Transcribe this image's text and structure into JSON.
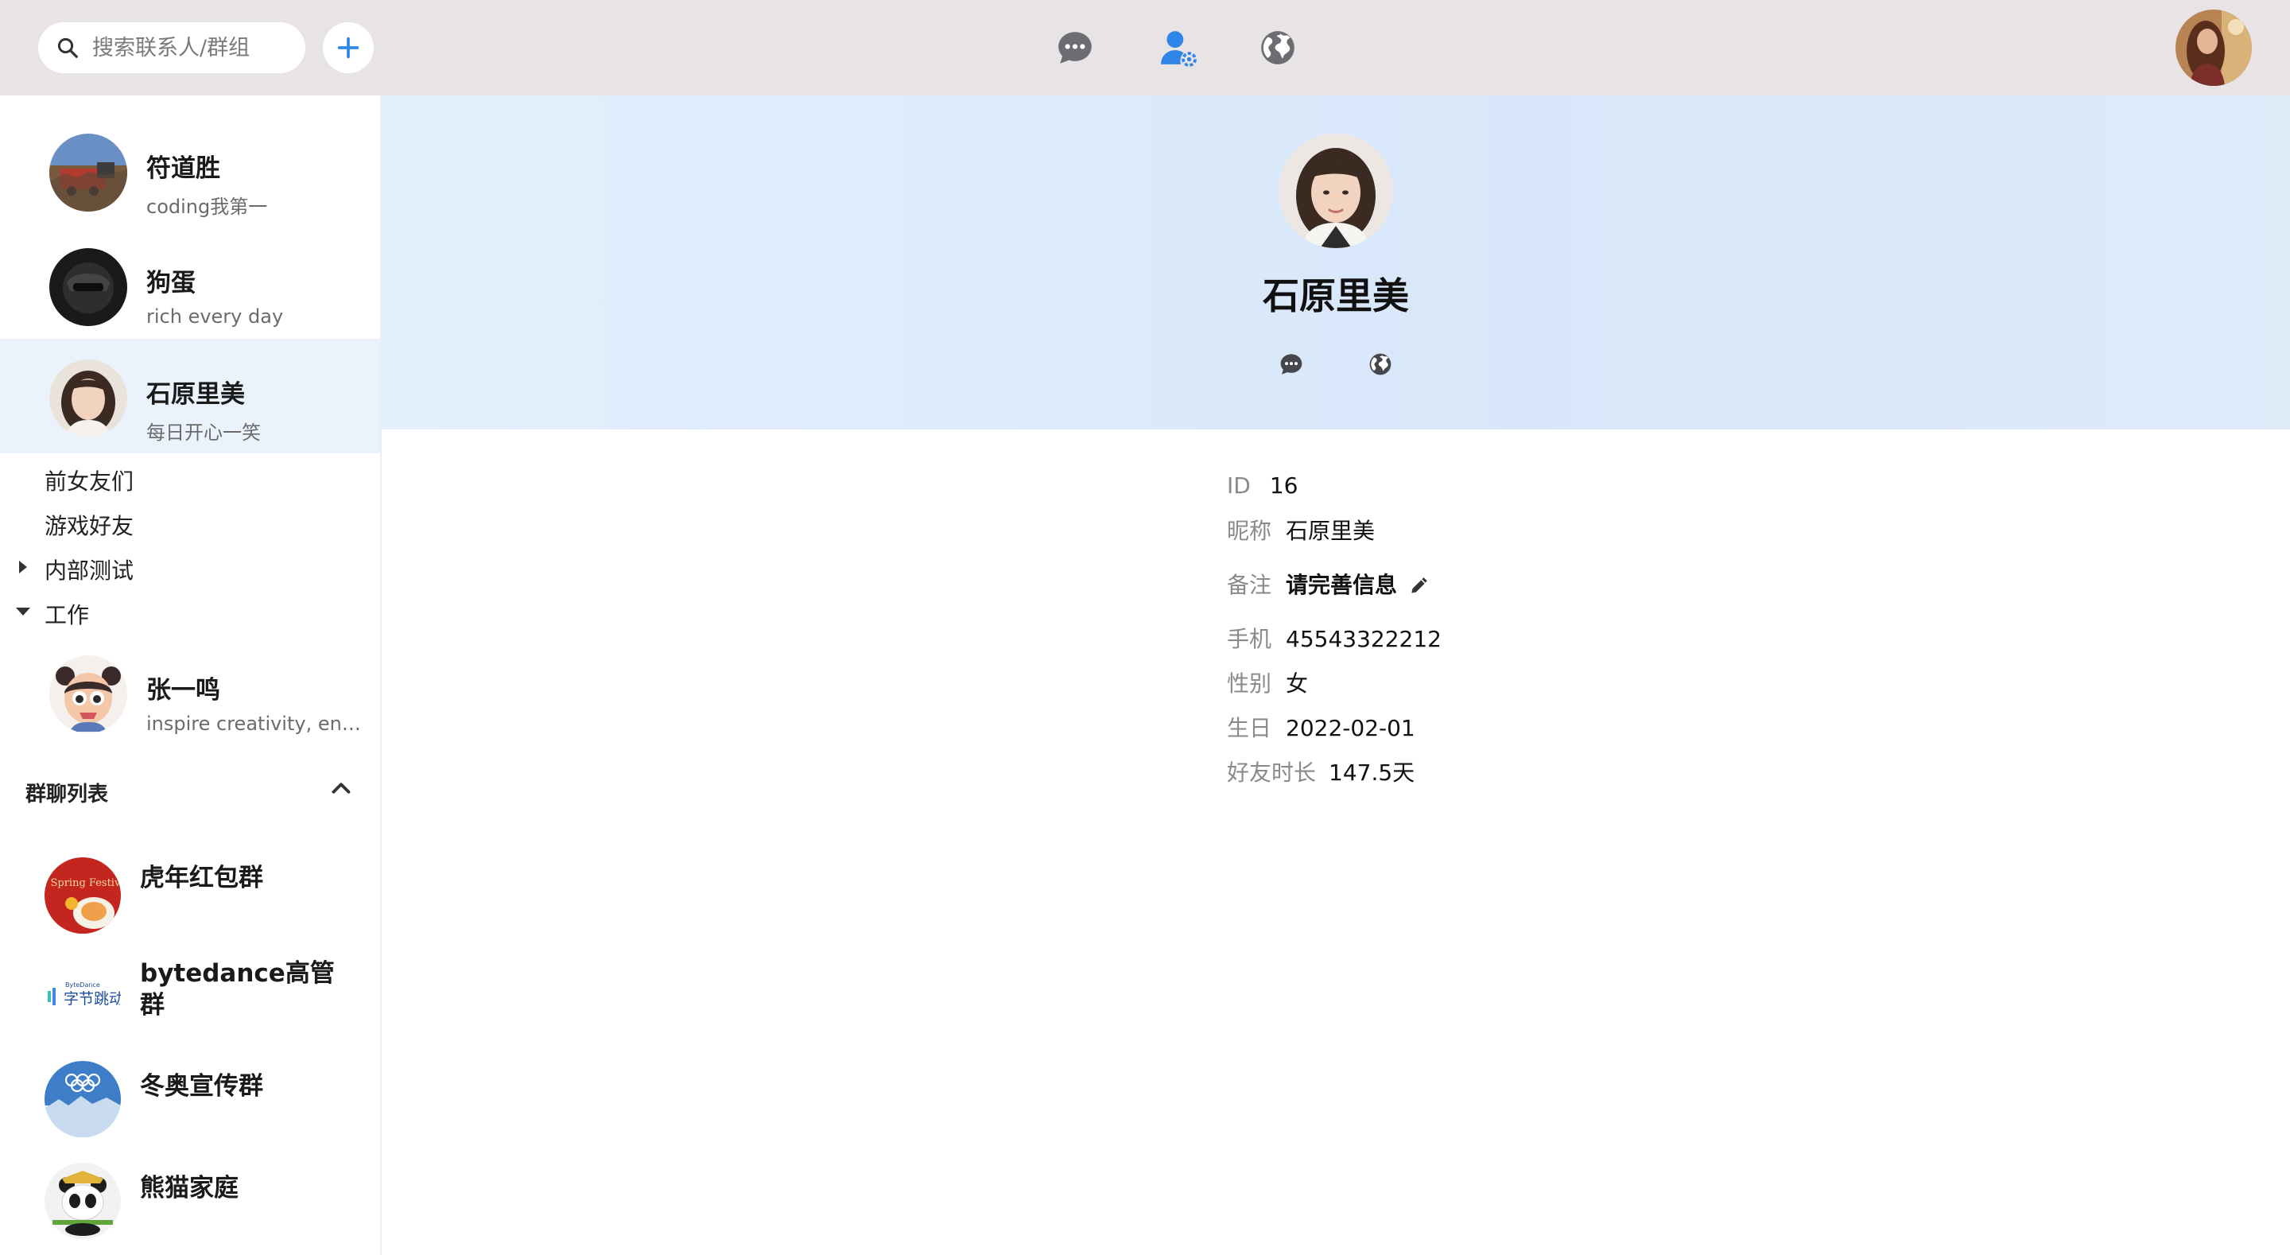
{
  "header": {
    "search_placeholder": "搜索联系人/群组",
    "add_icon": "plus-icon",
    "nav": [
      {
        "icon": "chat-bubble-icon",
        "active": false
      },
      {
        "icon": "contacts-icon",
        "active": true
      },
      {
        "icon": "globe-icon",
        "active": false
      }
    ],
    "user_avatar": "user-avatar-photo",
    "colors": {
      "bar": "#e8e3e5",
      "accent": "#2f86e8",
      "icon_gray": "#6b6d72"
    }
  },
  "contacts": [
    {
      "name": "符道胜",
      "sign": "coding我第一",
      "selected": false
    },
    {
      "name": "狗蛋",
      "sign": "rich every day",
      "selected": false
    },
    {
      "name": "石原里美",
      "sign": "每日开心一笑",
      "selected": true
    }
  ],
  "groups": [
    {
      "label": "前女友们",
      "expandable": false
    },
    {
      "label": "游戏好友",
      "expandable": false
    },
    {
      "label": "内部测试",
      "expandable": true,
      "expanded": false
    },
    {
      "label": "工作",
      "expandable": true,
      "expanded": true
    }
  ],
  "work_contacts": [
    {
      "name": "张一鸣",
      "sign": "inspire creativity, enri..."
    }
  ],
  "group_chats": {
    "title": "群聊列表",
    "toggle_icon": "chevron-up-icon",
    "items": [
      {
        "name": "虎年红包群",
        "avatar_text": "y Spring Festival"
      },
      {
        "name": "bytedance高管群",
        "avatar_text": "字节跳动",
        "avatar_subtext": "ByteDance"
      },
      {
        "name": "冬奥宣传群"
      },
      {
        "name": "熊猫家庭"
      }
    ]
  },
  "profile": {
    "name": "石原里美",
    "actions": [
      "chat-bubble-icon",
      "globe-icon"
    ],
    "fields": {
      "id_label": "ID",
      "id_value": "16",
      "nickname_label": "昵称",
      "nickname_value": "石原里美",
      "remark_label": "备注",
      "remark_value": "请完善信息",
      "phone_label": "手机",
      "phone_value": "45543322212",
      "gender_label": "性别",
      "gender_value": "女",
      "birthday_label": "生日",
      "birthday_value": "2022-02-01",
      "duration_label": "好友时长",
      "duration_value": "147.5天"
    }
  }
}
